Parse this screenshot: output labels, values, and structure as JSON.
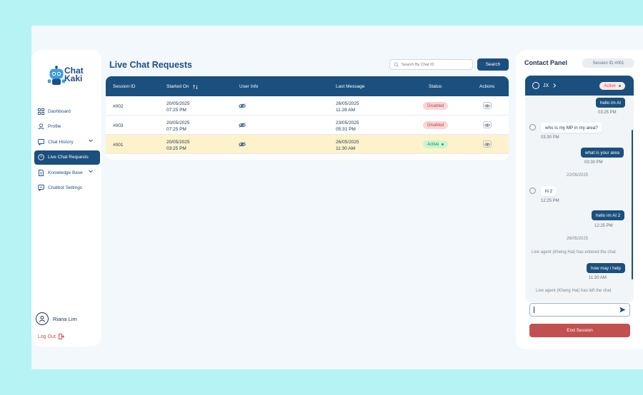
{
  "sidebar": {
    "brand": [
      "Chat",
      "Kaki"
    ],
    "items": [
      {
        "label": "Dashboard",
        "icon": "grid-icon"
      },
      {
        "label": "Profile",
        "icon": "user-icon"
      },
      {
        "label": "Chat History",
        "icon": "chat-icon"
      },
      {
        "label": "Live Chat Requests",
        "icon": "clock-icon"
      },
      {
        "label": "Knowledge Base",
        "icon": "document-icon"
      },
      {
        "label": "Chatbot Settings",
        "icon": "message-settings-icon"
      }
    ],
    "user_name": "Riana Lim",
    "logout_label": "Log Out"
  },
  "main": {
    "title": "Live Chat Requests",
    "search_placeholder": "Search By Chat ID",
    "search_button": "Search",
    "columns": [
      "Session ID",
      "Started On",
      "User Info",
      "Last Message",
      "Status",
      "Actions"
    ],
    "rows": [
      {
        "id": "#002",
        "started_date": "20/05/2025",
        "started_time": "07:25 PM",
        "last_date": "26/05/2025",
        "last_time": "11:28 AM",
        "status": "Disabled"
      },
      {
        "id": "#003",
        "started_date": "20/05/2025",
        "started_time": "07:25 PM",
        "last_date": "23/05/2025",
        "last_time": "05:31 PM",
        "status": "Disabled"
      },
      {
        "id": "#001",
        "started_date": "20/05/2025",
        "started_time": "03:25 PM",
        "last_date": "26/05/2025",
        "last_time": "11:30 AM",
        "status": "Active"
      }
    ]
  },
  "contact_panel": {
    "title": "Contact Panel",
    "session_id": "Session ID #001",
    "user_initials": "JX",
    "status": "Active",
    "messages": [
      {
        "text": "hello im AI",
        "time": "03:25 PM"
      },
      {
        "text": "who is my MP in my area?",
        "time": "03:30 PM"
      },
      {
        "text": "what is your area",
        "time": "03:30 PM"
      },
      {
        "date": "22/05/2025"
      },
      {
        "text": "hi 2",
        "time": "12:25 PM"
      },
      {
        "text": "hello im AI 2",
        "time": "12:25 PM"
      },
      {
        "date": "26/05/2025"
      },
      {
        "system": "Live agent (Kheng Hai) has entered the chat"
      },
      {
        "text": "how may i help",
        "time": "11:30 AM"
      },
      {
        "system": "Live agent (Kheng Hai) has left the chat"
      }
    ],
    "end_button": "End Session"
  }
}
